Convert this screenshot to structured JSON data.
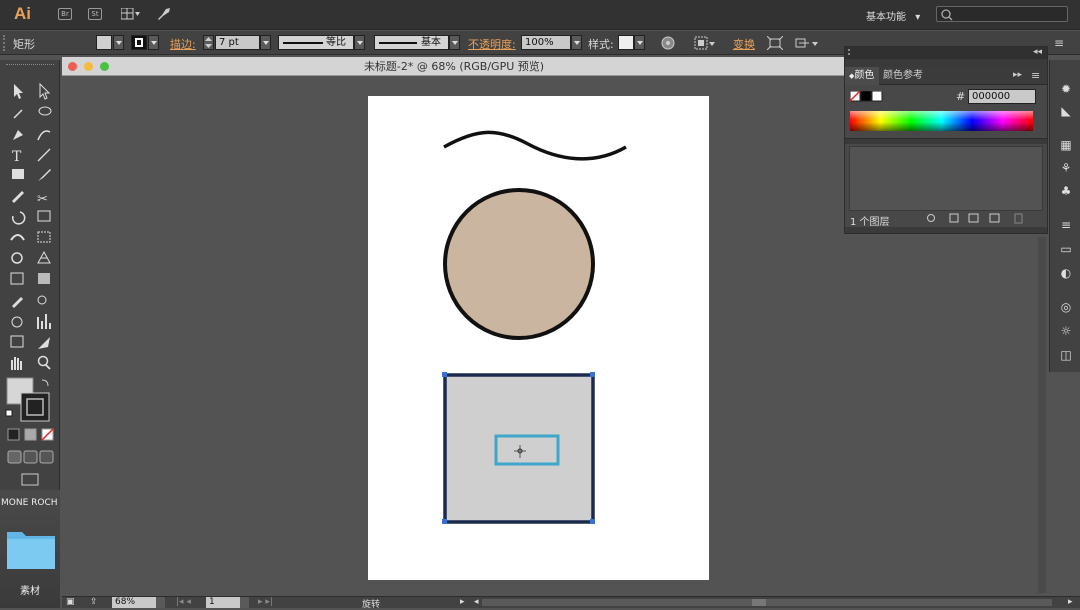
{
  "app": {
    "logo": "Ai",
    "bridge": "Br",
    "stock": "St",
    "workspace_label": "基本功能",
    "search_placeholder": ""
  },
  "control_bar": {
    "object_type": "矩形",
    "stroke_label": "描边:",
    "stroke_weight": "7 pt",
    "profile_label": "等比",
    "brush_label": "基本",
    "opacity_label": "不透明度:",
    "opacity_value": "100%",
    "style_label": "样式:",
    "transform_label": "变换"
  },
  "document": {
    "title": "未标题-2* @ 68% (RGB/GPU 预览)"
  },
  "color_panel": {
    "tabs": [
      "颜色",
      "颜色参考"
    ],
    "hex_value": "000000",
    "hex_symbol": "#"
  },
  "layers_panel": {
    "count_label": "1 个图层"
  },
  "status_bar": {
    "zoom": "68%",
    "page": "1",
    "tool_name": "旋转"
  },
  "desktop": {
    "sidebar_label": "MONE ROCH",
    "folder_label": "素材"
  },
  "colors": {
    "circle_fill": "#c9b5a0",
    "rect_fill": "#cfcfcf",
    "rect_stroke": "#1b2a4e",
    "selection_box": "#3fa7c9",
    "accent": "#e8a15a"
  }
}
